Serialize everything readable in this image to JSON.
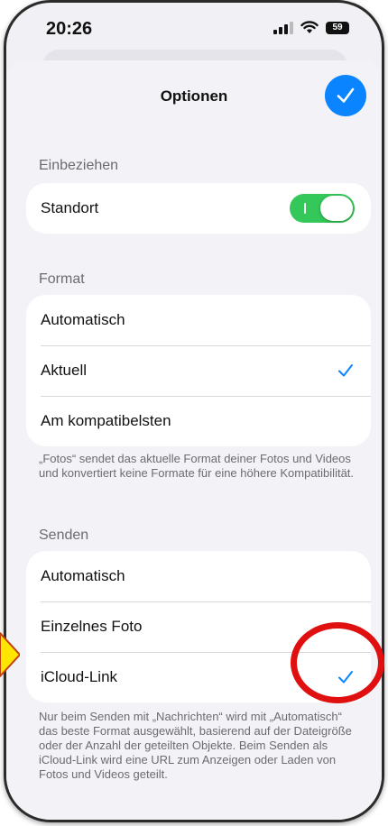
{
  "status": {
    "time": "20:26",
    "battery": "59"
  },
  "sheet": {
    "title": "Optionen"
  },
  "include": {
    "header": "Einbeziehen",
    "location_label": "Standort",
    "location_enabled": true
  },
  "format": {
    "header": "Format",
    "options": [
      "Automatisch",
      "Aktuell",
      "Am kompatibelsten"
    ],
    "selected": "Aktuell",
    "footnote": "„Fotos“ sendet das aktuelle Format deiner Fotos und Videos und konvertiert keine Formate für eine höhere Kompatibilität."
  },
  "send": {
    "header": "Senden",
    "options": [
      "Automatisch",
      "Einzelnes Foto",
      "iCloud-Link"
    ],
    "selected": "iCloud-Link",
    "footnote": "Nur beim Senden mit „Nachrichten“ wird mit „Automatisch“ das beste Format ausgewählt, basierend auf der Dateigröße oder der Anzahl der geteilten Objekte. Beim Senden als iCloud-Link wird eine URL zum Anzeigen oder Laden von Fotos und Videos geteilt."
  },
  "colors": {
    "accent": "#0a84ff",
    "toggle_on": "#34c759",
    "annotation": "#e01010",
    "arrow": "#ffe600"
  }
}
